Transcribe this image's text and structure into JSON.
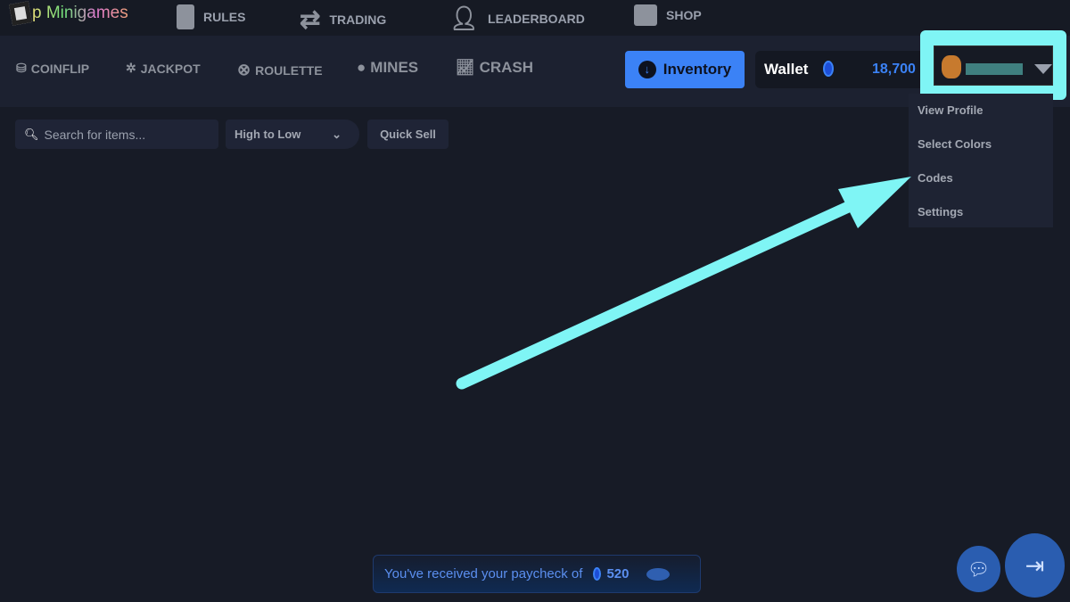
{
  "header": {
    "logo_text": "p Minigames",
    "nav": [
      {
        "label": "RULES",
        "icon": "book-icon"
      },
      {
        "label": "TRADING",
        "icon": "swap-arrows-icon"
      },
      {
        "label": "LEADERBOARD",
        "icon": "user-icon"
      },
      {
        "label": "SHOP",
        "icon": "store-icon"
      }
    ]
  },
  "games": [
    {
      "label": "COINFLIP",
      "icon": "coins-icon"
    },
    {
      "label": "JACKPOT",
      "icon": "wheel-icon"
    },
    {
      "label": "ROULETTE",
      "icon": "roulette-icon"
    },
    {
      "label": "MINES",
      "icon": "bomb-icon"
    },
    {
      "label": "CRASH",
      "icon": "chart-icon"
    }
  ],
  "inventory_label": "Inventory",
  "wallet": {
    "label": "Wallet",
    "balance": "18,700"
  },
  "user_menu": {
    "items": [
      "View Profile",
      "Select Colors",
      "Codes",
      "Settings"
    ]
  },
  "toolbar": {
    "search_placeholder": "Search for items...",
    "sort_value": "High to Low",
    "quick_sell": "Quick Sell"
  },
  "toast": {
    "text": "You've received your paycheck of",
    "amount": "520"
  },
  "colors": {
    "accent": "#3b82f6",
    "highlight": "#7ff5f5",
    "background": "#171b26"
  }
}
